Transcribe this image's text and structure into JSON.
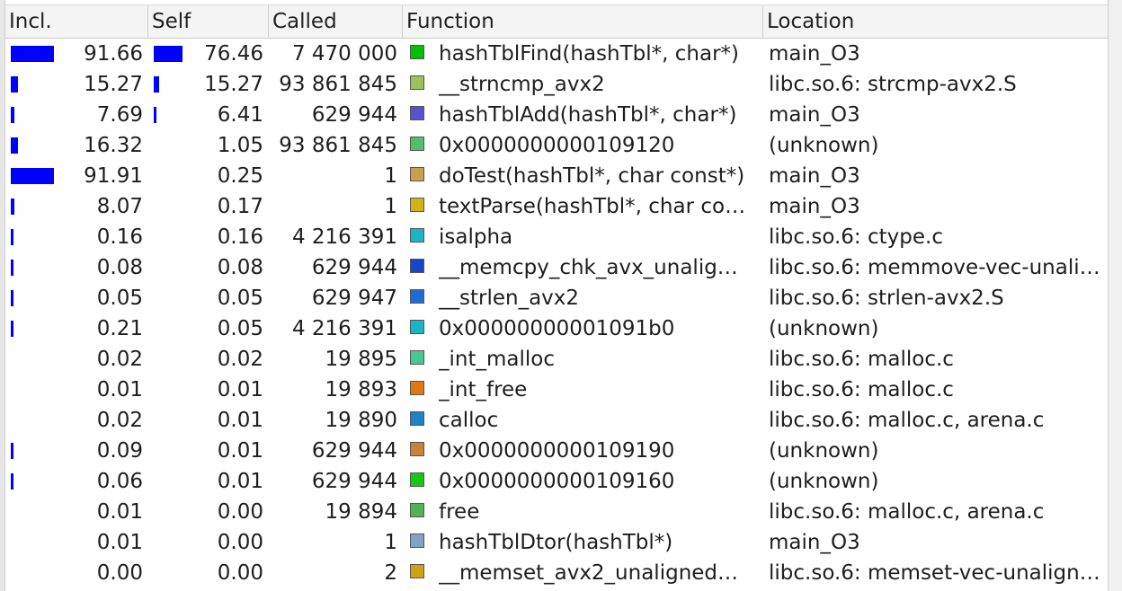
{
  "columns": {
    "incl": "Incl.",
    "self": "Self",
    "called": "Called",
    "function": "Function",
    "location": "Location"
  },
  "bar_color": "#0000ff",
  "rows": [
    {
      "incl": "91.66",
      "incl_frac": 0.9166,
      "self": "76.46",
      "self_frac": 0.7646,
      "called": "7 470 000",
      "color": "#00c000",
      "function": "hashTblFind(hashTbl*, char*)",
      "location": "main_O3"
    },
    {
      "incl": "15.27",
      "incl_frac": 0.1527,
      "self": "15.27",
      "self_frac": 0.1527,
      "called": "93 861 845",
      "color": "#9bc35a",
      "function": "__strncmp_avx2",
      "location": "libc.so.6: strcmp-avx2.S"
    },
    {
      "incl": "7.69",
      "incl_frac": 0.0769,
      "self": "6.41",
      "self_frac": 0.0641,
      "called": "629 944",
      "color": "#5a50d2",
      "function": "hashTblAdd(hashTbl*, char*)",
      "location": "main_O3"
    },
    {
      "incl": "16.32",
      "incl_frac": 0.1632,
      "self": "1.05",
      "self_frac": 0.0105,
      "called": "93 861 845",
      "color": "#55be6e",
      "function": "0x0000000000109120",
      "location": "(unknown)"
    },
    {
      "incl": "91.91",
      "incl_frac": 0.9191,
      "self": "0.25",
      "self_frac": 0.0025,
      "called": "1",
      "color": "#c8a050",
      "function": "doTest(hashTbl*, char const*)",
      "location": "main_O3"
    },
    {
      "incl": "8.07",
      "incl_frac": 0.0807,
      "self": "0.17",
      "self_frac": 0.0017,
      "called": "1",
      "color": "#d2b419",
      "function": "textParse(hashTbl*, char co…",
      "location": "main_O3"
    },
    {
      "incl": "0.16",
      "incl_frac": 0.0016,
      "self": "0.16",
      "self_frac": 0.0016,
      "called": "4 216 391",
      "color": "#19b4c8",
      "function": "isalpha",
      "location": "libc.so.6: ctype.c"
    },
    {
      "incl": "0.08",
      "incl_frac": 0.0008,
      "self": "0.08",
      "self_frac": 0.0008,
      "called": "629 944",
      "color": "#1946c8",
      "function": "__memcpy_chk_avx_unalig…",
      "location": "libc.so.6: memmove-vec-unali…"
    },
    {
      "incl": "0.05",
      "incl_frac": 0.0005,
      "self": "0.05",
      "self_frac": 0.0005,
      "called": "629 947",
      "color": "#1e6ed2",
      "function": "__strlen_avx2",
      "location": "libc.so.6: strlen-avx2.S"
    },
    {
      "incl": "0.21",
      "incl_frac": 0.0021,
      "self": "0.05",
      "self_frac": 0.0005,
      "called": "4 216 391",
      "color": "#19b4c8",
      "function": "0x00000000001091b0",
      "location": "(unknown)"
    },
    {
      "incl": "0.02",
      "incl_frac": 0.0002,
      "self": "0.02",
      "self_frac": 0.0002,
      "called": "19 895",
      "color": "#46c896",
      "function": "_int_malloc",
      "location": "libc.so.6: malloc.c"
    },
    {
      "incl": "0.01",
      "incl_frac": 0.0001,
      "self": "0.01",
      "self_frac": 0.0001,
      "called": "19 893",
      "color": "#e07814",
      "function": "_int_free",
      "location": "libc.so.6: malloc.c"
    },
    {
      "incl": "0.02",
      "incl_frac": 0.0002,
      "self": "0.01",
      "self_frac": 0.0001,
      "called": "19 890",
      "color": "#1e82c8",
      "function": "calloc",
      "location": "libc.so.6: malloc.c, arena.c"
    },
    {
      "incl": "0.09",
      "incl_frac": 0.0009,
      "self": "0.01",
      "self_frac": 0.0001,
      "called": "629 944",
      "color": "#c8823c",
      "function": "0x0000000000109190",
      "location": "(unknown)"
    },
    {
      "incl": "0.06",
      "incl_frac": 0.0006,
      "self": "0.01",
      "self_frac": 0.0001,
      "called": "629 944",
      "color": "#14c814",
      "function": "0x0000000000109160",
      "location": "(unknown)"
    },
    {
      "incl": "0.01",
      "incl_frac": 0.0001,
      "self": "0.00",
      "self_frac": 0.0,
      "called": "19 894",
      "color": "#50b450",
      "function": "free",
      "location": "libc.so.6: malloc.c, arena.c"
    },
    {
      "incl": "0.01",
      "incl_frac": 0.0001,
      "self": "0.00",
      "self_frac": 0.0,
      "called": "1",
      "color": "#82a0c8",
      "function": "hashTblDtor(hashTbl*)",
      "location": "main_O3"
    },
    {
      "incl": "0.00",
      "incl_frac": 0.0,
      "self": "0.00",
      "self_frac": 0.0,
      "called": "2",
      "color": "#d2a014",
      "function": "__memset_avx2_unaligned…",
      "location": "libc.so.6: memset-vec-unalign…"
    }
  ]
}
